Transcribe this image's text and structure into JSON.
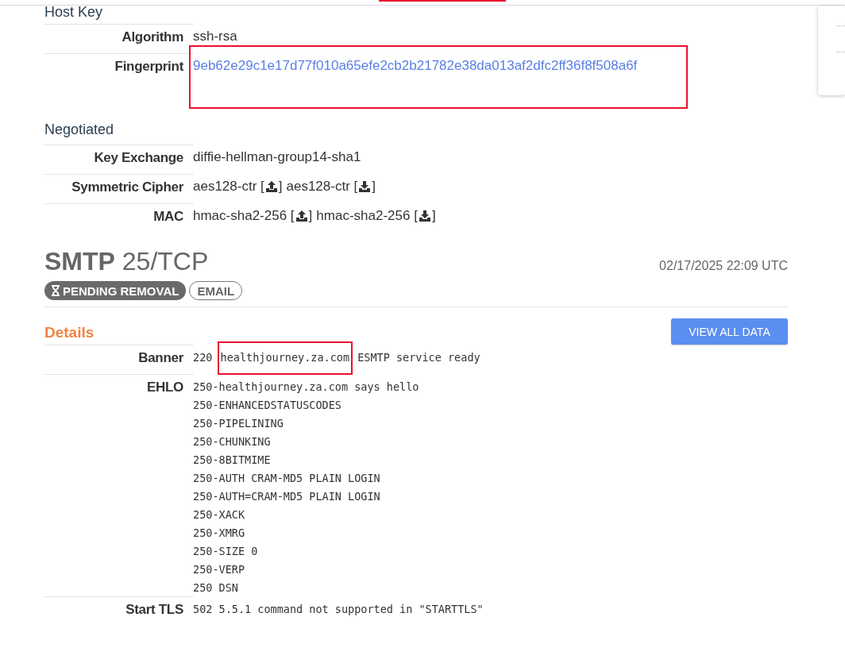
{
  "top_marker": {
    "highlighted": true
  },
  "host_key": {
    "title": "Host Key",
    "rows": [
      {
        "label": "Algorithm",
        "value": "ssh-rsa",
        "kind": "text"
      },
      {
        "label": "Fingerprint",
        "value": "9eb62e29c1e17d77f010a65efe2cb2b21782e38da013af2dfc2ff36f8f508a6f",
        "kind": "link",
        "highlighted": true
      }
    ]
  },
  "negotiated": {
    "title": "Negotiated",
    "rows": [
      {
        "label": "Key Exchange",
        "kind": "text",
        "value": "diffie-hellman-group14-sha1"
      },
      {
        "label": "Symmetric Cipher",
        "kind": "directional",
        "parts": [
          {
            "text": "aes128-ctr [",
            "kind": "upload",
            "close": "]"
          },
          {
            "text": "aes128-ctr [",
            "kind": "download",
            "close": "]"
          }
        ]
      },
      {
        "label": "MAC",
        "kind": "directional",
        "parts": [
          {
            "text": "hmac-sha2-256 [",
            "kind": "upload",
            "close": "]"
          },
          {
            "text": "hmac-sha2-256 [",
            "kind": "download",
            "close": "]"
          }
        ]
      }
    ]
  },
  "service": {
    "name": "SMTP",
    "port": "25/TCP",
    "timestamp": "02/17/2025 22:09 UTC",
    "tags": [
      {
        "label": "PENDING REMOVAL",
        "kind": "status"
      },
      {
        "label": "EMAIL",
        "kind": "outline"
      }
    ],
    "details_title": "Details",
    "button": "VIEW ALL DATA",
    "rows": [
      {
        "label": "Banner",
        "kind": "mono",
        "parts": [
          {
            "text": "220 "
          },
          {
            "text": "healthjourney.za.com",
            "highlighted": true
          },
          {
            "text": " ESMTP service ready"
          }
        ]
      },
      {
        "label": "EHLO",
        "kind": "lines",
        "lines": [
          "250-healthjourney.za.com says hello",
          "250-ENHANCEDSTATUSCODES",
          "250-PIPELINING",
          "250-CHUNKING",
          "250-8BITMIME",
          "250-AUTH CRAM-MD5 PLAIN LOGIN",
          "250-AUTH=CRAM-MD5 PLAIN LOGIN",
          "250-XACK",
          "250-XMRG",
          "250-SIZE 0",
          "250-VERP",
          "250 DSN"
        ]
      },
      {
        "label": "Start TLS",
        "kind": "mono",
        "parts": [
          {
            "text": "502 5.5.1 command not supported in \"STARTTLS\""
          }
        ]
      }
    ]
  }
}
